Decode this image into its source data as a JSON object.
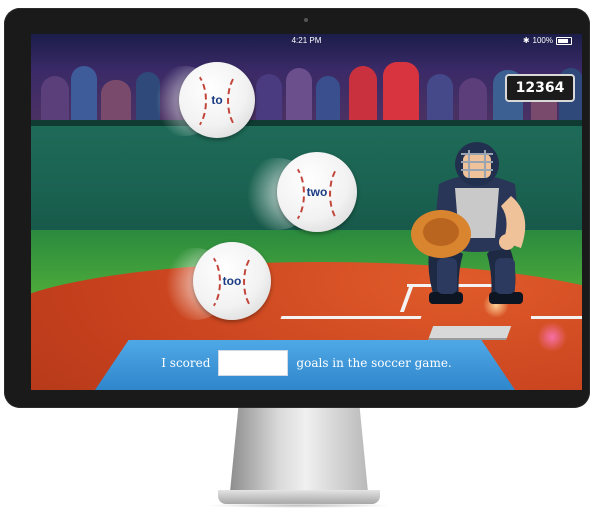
{
  "status_bar": {
    "time": "4:21 PM",
    "battery": "100%"
  },
  "score": "12364",
  "balls": [
    {
      "word": "to"
    },
    {
      "word": "two"
    },
    {
      "word": "too"
    }
  ],
  "sentence": {
    "before": "I scored",
    "after": "goals in the soccer game.",
    "answer_value": ""
  },
  "colors": {
    "sentence_bar": "#2f86cb",
    "ball_text": "#1b3b82",
    "dirt": "#c6401d",
    "grass": "#4caa39"
  }
}
